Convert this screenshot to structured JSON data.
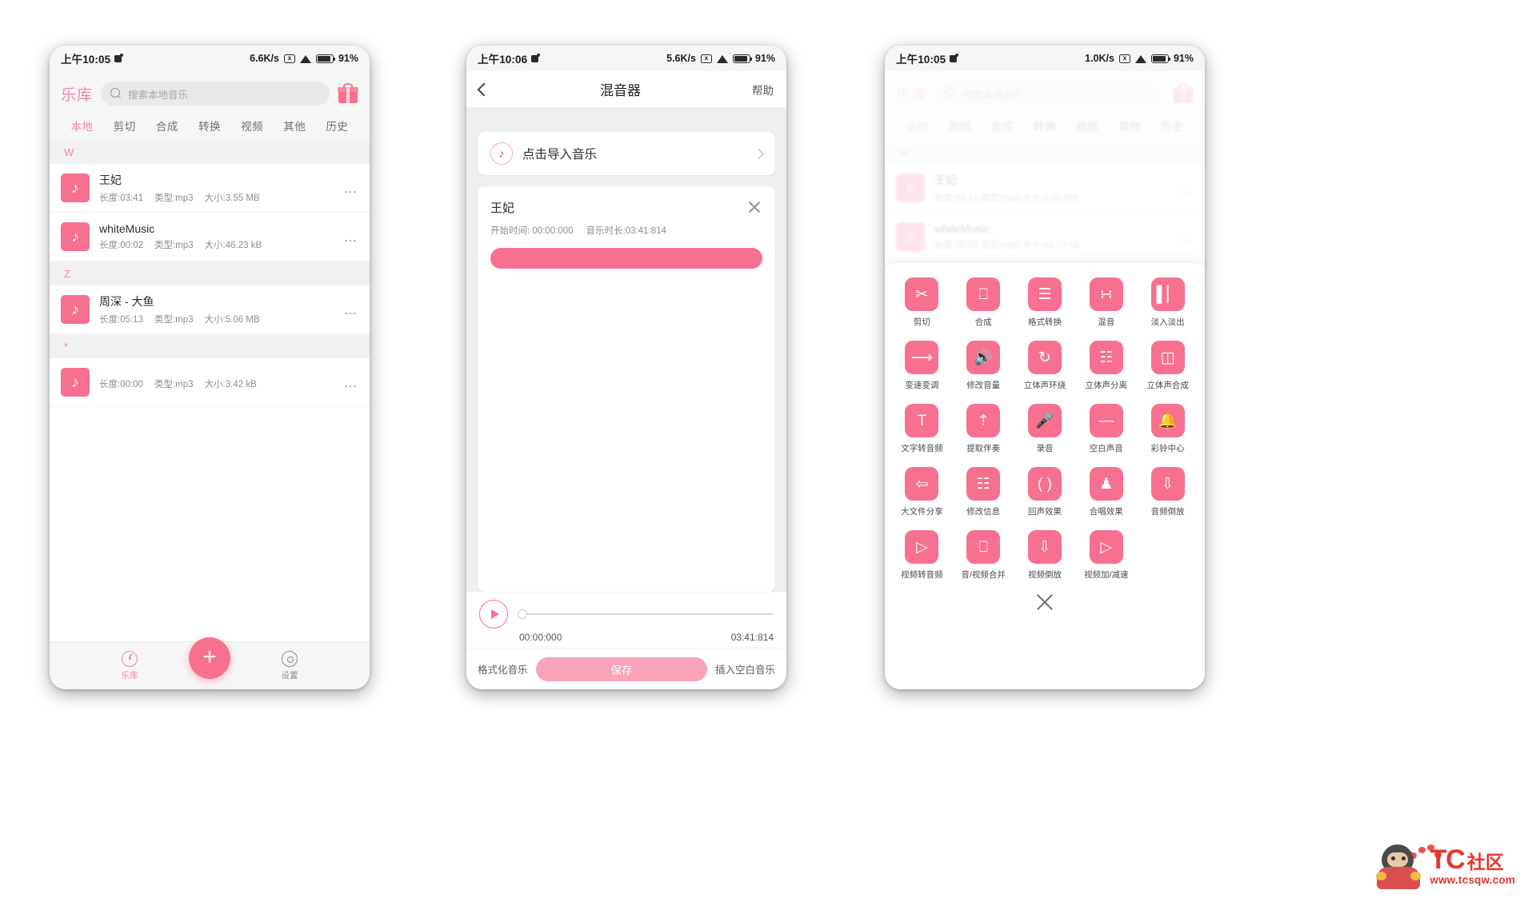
{
  "phone1": {
    "status": {
      "time": "上午10:05",
      "speed": "6.6K/s",
      "battery": "91%",
      "icons": [
        "coffee-cup-icon",
        "x-badge-icon",
        "wifi-icon",
        "battery-icon"
      ]
    },
    "header": {
      "title": "乐库",
      "gift_icon": "gift-icon"
    },
    "search": {
      "placeholder": "搜索本地音乐",
      "icon": "search-icon"
    },
    "tabs": [
      {
        "label": "本地",
        "active": true
      },
      {
        "label": "剪切",
        "active": false
      },
      {
        "label": "合成",
        "active": false
      },
      {
        "label": "转换",
        "active": false
      },
      {
        "label": "视频",
        "active": false
      },
      {
        "label": "其他",
        "active": false
      },
      {
        "label": "历史",
        "active": false
      }
    ],
    "sections": [
      {
        "letter": "W",
        "tracks": [
          {
            "name": "王妃",
            "duration": "长度:03:41",
            "type": "类型:mp3",
            "size": "大小:3.55 MB"
          },
          {
            "name": "whiteMusic",
            "duration": "长度:00:02",
            "type": "类型:mp3",
            "size": "大小:46.23 kB"
          }
        ]
      },
      {
        "letter": "Z",
        "tracks": [
          {
            "name": "周深 - 大鱼",
            "duration": "长度:05:13",
            "type": "类型:mp3",
            "size": "大小:5.06 MB"
          }
        ]
      },
      {
        "letter": "*",
        "tracks": [
          {
            "name": "",
            "duration": "长度:00:00",
            "type": "类型:mp3",
            "size": "大小:3.42 kB"
          }
        ]
      }
    ],
    "bottom_nav": [
      {
        "label": "乐库",
        "icon": "disc-icon",
        "active": true
      },
      {
        "label": "设置",
        "icon": "gear-icon",
        "active": false
      }
    ],
    "fab": {
      "label": "+",
      "icon": "plus-icon"
    }
  },
  "phone2": {
    "status": {
      "time": "上午10:06",
      "speed": "5.6K/s",
      "battery": "91%"
    },
    "nav": {
      "back_icon": "back-chevron-icon",
      "title": "混音器",
      "action": "帮助"
    },
    "import": {
      "label": "点击导入音乐",
      "icon": "music-note-icon",
      "chevron": "chevron-right-icon"
    },
    "clip": {
      "title": "王妃",
      "start_label": "开始时间:",
      "start_value": "00:00:000",
      "duration_label": "音乐时长:",
      "duration_value": "03:41:814",
      "close_icon": "close-icon"
    },
    "transport": {
      "play_icon": "play-icon",
      "current_time": "00:00:000",
      "total_time": "03:41:814",
      "slider_position": 0
    },
    "actions": {
      "left": "格式化音乐",
      "save": "保存",
      "right": "插入空白音乐"
    }
  },
  "phone3": {
    "status": {
      "time": "上午10:05",
      "speed": "1.0K/s",
      "battery": "91%"
    },
    "close_icon": "close-icon",
    "tools": [
      {
        "label": "剪切",
        "icon": "scissors-icon"
      },
      {
        "label": "合成",
        "icon": "merge-icon"
      },
      {
        "label": "格式转换",
        "icon": "format-convert-icon"
      },
      {
        "label": "混音",
        "icon": "mix-icon"
      },
      {
        "label": "淡入淡出",
        "icon": "fade-icon"
      },
      {
        "label": "变速变调",
        "icon": "speed-pitch-icon"
      },
      {
        "label": "修改音量",
        "icon": "volume-icon"
      },
      {
        "label": "立体声环绕",
        "icon": "surround-icon"
      },
      {
        "label": "立体声分离",
        "icon": "split-icon"
      },
      {
        "label": "立体声合成",
        "icon": "cube-icon"
      },
      {
        "label": "文字转音频",
        "icon": "text-to-audio-icon"
      },
      {
        "label": "提取伴奏",
        "icon": "extract-icon"
      },
      {
        "label": "录音",
        "icon": "microphone-icon"
      },
      {
        "label": "空白声音",
        "icon": "silence-icon"
      },
      {
        "label": "彩铃中心",
        "icon": "bell-icon"
      },
      {
        "label": "大文件分享",
        "icon": "share-icon"
      },
      {
        "label": "修改信息",
        "icon": "edit-info-icon"
      },
      {
        "label": "回声效果",
        "icon": "echo-icon"
      },
      {
        "label": "合唱效果",
        "icon": "chorus-icon"
      },
      {
        "label": "音频倒放",
        "icon": "audio-reverse-icon"
      },
      {
        "label": "视频转音频",
        "icon": "video-to-audio-icon"
      },
      {
        "label": "音/视频合并",
        "icon": "av-merge-icon"
      },
      {
        "label": "视频倒放",
        "icon": "video-reverse-icon"
      },
      {
        "label": "视频加/减速",
        "icon": "video-speed-icon"
      }
    ],
    "ghost": {
      "header": {
        "title": "乐库"
      },
      "search_placeholder": "搜索本地音乐",
      "tabs": [
        "本地",
        "剪切",
        "合成",
        "转换",
        "视频",
        "其他",
        "历史"
      ],
      "section_letter": "W",
      "tracks": [
        {
          "name": "王妃",
          "meta": "长度:03:41  类型:mp3  大小:3.55 MB"
        },
        {
          "name": "whiteMusic",
          "meta": "长度:00:02  类型:mp3  大小:46.23 kB"
        }
      ]
    }
  },
  "watermark": {
    "brand": "TC",
    "suffix": "社区",
    "url": "www.tcsqw.com"
  },
  "colors": {
    "accent": "#f8708f",
    "accent_soft": "#f2879f",
    "text": "#2b2b2b",
    "muted": "#8e8e8e"
  }
}
